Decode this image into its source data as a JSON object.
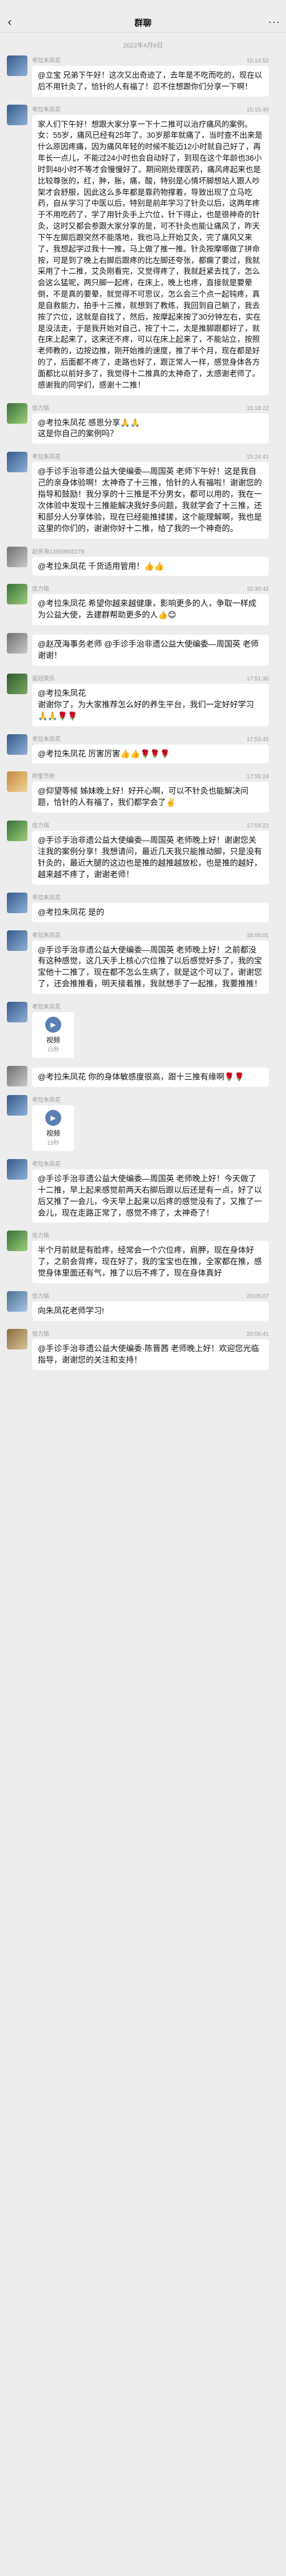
{
  "status": {
    "left": "",
    "right": ""
  },
  "nav": {
    "title": "群聊"
  },
  "date": "2022年4月6日",
  "messages": [
    {
      "name": "考拉朱凤花",
      "time": "15:14:52",
      "avatar": "a",
      "big": true,
      "text": "@立宝 兄弟下午好！这次又出奇迹了，去年是不吃而吃的，现在以后不用针灸了，恰针的人有福了！忍不住想跟你们分享一下啊！"
    },
    {
      "name": "考拉朱凤花",
      "time": "15:15:40",
      "avatar": "a",
      "big": true,
      "text": "家人们下午好！想跟大家分享一下十二推可以治疗痛风的案例。女：55岁，痛风已经有25年了。30岁那年就痛了，当时查不出来是什么原因疼痛，因为痛风年轻的时候不能迈12小时就自己好了，再年长一点儿，不能过24小时也会自动好了，到现在这个年龄也36小时到48小时不等才会慢慢好了。期间刚处理医药，痛风疼起来也是比较尊张的，红，肿，胀，痛，酸，特别是心情坏脚想站人跟人吵架才会舒服，因此这么多年都是靠药物撑着，导致出现了立马吃药，自从学习了中医以后，特别是前年学习了针灸以后，这两年疼于不用吃药了，学了用针灸手上穴位，针下得止，也是很神奇的针灸，这时又都会参跟大家分享的是，可不针灸也能让痛风了，昨天下午左脚后跟突然不能落地，我也马上开始艾灸，完了痛风又来了，我想起学过我十一推，马上做了推一推。针灸按摩哪做了拼命按，可是到了晚上右脚后跟疼的比左脚还夸张，都瘸了要过，我就采用了十二推，艾灸刚看完，又觉得疼了，我就赶紧去找了，怎么会这么猛呢，两只脚一起疼，在床上，晚上也疼，直接就是要晕倒，不是真的要晕，就觉得不可思议，怎么会三个点一起钝疼，真是自救能力，拍手十三推，就想到了教练，我回到自己躺了，我去按了穴位，这就是自找了，然后，按摩起来按了30分钟左右，实在是没法走，于是我开始对自己，按了十二，太是推脚跟都好了，就在床上起来了，这来还不疼，可以在床上起来了，不能站立，按照老师教的，边按边推，刚开始推的速度，推了半个月，现在都是好的了，后面都不疼了，走路也好了，跟正常人一样，感觉身体各方面都比以前好多了，我觉得十二推真的太神奇了，太感谢老师了。感谢我的同学们，感谢十二推！"
    },
    {
      "name": "信力铭",
      "time": "15:18:22",
      "avatar": "b",
      "big": false,
      "text": "@考拉朱凤花 感恩分享🙏🙏\n这是你自己的案例吗？"
    },
    {
      "name": "考拉朱凤花",
      "time": "15:24:41",
      "avatar": "a",
      "big": false,
      "text": "@手诊手治非遗公益大使编委—周国英 老师下午好！这是我自己的亲身体验啊！太神奇了十三推，恰针的人有福啦！谢谢您的指导和鼓励！我分享的十三推是不分男女，都可以用的，我在一次体验中发现十三推能解决我好多问题，我就学会了十三推，还和部分人分享体验，现在已经能推揉搓，这个能理解啊，我也是这里的你们的，谢谢你好十二推，给了我的一个神奇的。"
    },
    {
      "name": "赵亮海13959855278",
      "time": "",
      "avatar": "c",
      "big": false,
      "text": "@考拉朱凤花 千货适用管用！👍👍"
    },
    {
      "name": "信力铭",
      "time": "15:30:42",
      "avatar": "b",
      "big": false,
      "text": "@考拉朱凤花 希望你越来越健康，影响更多的人，争取一样成为公益大使，去建群帮助更多的人👍😊"
    },
    {
      "name": "",
      "time": "",
      "avatar": "",
      "big": false,
      "text": "@赵茂海事务老师 @手诊手治非遗公益大使编委—周国英 老师 谢谢！"
    },
    {
      "name": "蓝冠荣乐",
      "time": "17:51:30",
      "avatar": "d",
      "big": false,
      "text": "@考拉朱凤花\n谢谢你了，为大家推荐怎么好的养生平台，我们一定好好学习🙏🙏🌹🌹"
    },
    {
      "name": "考拉朱凤花",
      "time": "17:53:45",
      "avatar": "a",
      "big": false,
      "text": "@考拉朱凤花 厉害厉害👍👍🌹🌹🌹"
    },
    {
      "name": "阿里节桥",
      "time": "17:55:24",
      "avatar": "e",
      "big": false,
      "text": "@仰望等候 姊妹晚上好！好开心啊，可以不针灸也能解决问题，恰针的人有福了，我们都学会了✌️"
    },
    {
      "name": "信力铭",
      "time": "17:59:22",
      "avatar": "b",
      "big": false,
      "text": "@手诊手治非遗公益大使编委—周国英 老师晚上好！谢谢您关注我的案例分享！我想请问，最近几天我只能推动脚，只是没有针灸的，最近大腿的这边也是推的越推越放松，也是推的越好，越来越不疼了，谢谢老师！"
    },
    {
      "name": "考拉朱凤花",
      "time": "",
      "avatar": "a",
      "big": false,
      "text": "@考拉朱凤花 是的"
    },
    {
      "name": "考拉朱凤花",
      "time": "18:00:01",
      "avatar": "a",
      "big": false,
      "text": "@手诊手治非遗公益大使编委—周国英 老师晚上好！之前都没有这种感觉，这几天手上核心穴位推了以后感觉好多了，我的宝宝他十二推了，现在都不怎么生病了，就是这个可以了，谢谢您了，还会推推看，明天接着推，我就想手了一起推，我要推推！"
    },
    {
      "name": "考拉朱凤花",
      "time": "",
      "avatar": "a",
      "big": false,
      "video": true,
      "video_label": "视频",
      "video_dur": "15秒"
    },
    {
      "name": "",
      "time": "",
      "avatar": "",
      "big": false,
      "text": "@考拉朱凤花 你的身体敏感度很高，跟十三推有缘啊🌹🌹"
    },
    {
      "name": "考拉朱凤花",
      "time": "",
      "avatar": "a",
      "big": false,
      "video": true,
      "video_label": "视频",
      "video_dur": "15秒"
    },
    {
      "name": "考拉朱凤花",
      "time": "",
      "avatar": "a",
      "big": false,
      "text": "@手诊手治非遗公益大使编委—周国英 老师晚上好！今天做了十二推，早上起来感觉前两天右脚后跟以后还是有一点，好了以后又推了一会儿，今天早上起来以后疼的感觉没有了，又推了一会儿，现在走路正常了，感觉不疼了，太神奇了！"
    },
    {
      "name": "信力铭",
      "time": "",
      "avatar": "b",
      "big": false,
      "text": "半个月前就是有脸疼，经常会一个穴位疼，肩胛，现在身体好了，之前会背疼，现在好了，我的宝宝也在推，全家都在推，感觉身体里面还有气，推了以后不疼了，现在身体真好"
    },
    {
      "name": "信力铭",
      "time": "20:05:07",
      "avatar": "f",
      "big": false,
      "text": "向朱凤花老师学习!"
    },
    {
      "name": "信力铭",
      "time": "20:06:41",
      "avatar": "g",
      "big": false,
      "text": "@手诊手治非遗公益大使编委·陈晋茜 老师晚上好！欢迎您光临指导，谢谢您的关注和支持！"
    }
  ],
  "icons": {
    "back": "chevron-left-icon",
    "more": "more-icon",
    "video": "play-icon"
  }
}
